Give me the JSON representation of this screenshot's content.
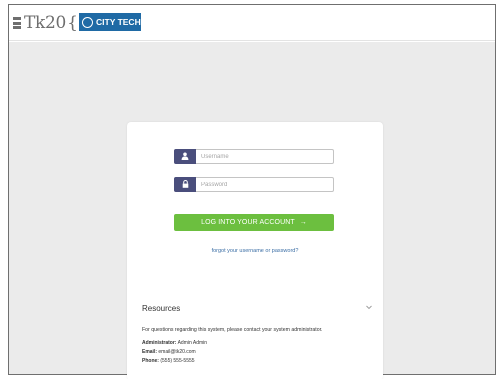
{
  "header": {
    "logo_text": "Tk20",
    "logo_brace": "{",
    "badge_text": "CITY TECH"
  },
  "login": {
    "username_placeholder": "Username",
    "password_placeholder": "Password",
    "login_label": "LOG INTO YOUR ACCOUNT",
    "login_arrow": "→",
    "forgot_link": "forgot your username or password?"
  },
  "resources": {
    "title": "Resources",
    "intro": "For questions regarding this system, please contact your system administrator.",
    "admin_label": "Administrator:",
    "admin_value": "Admin Admin",
    "email_label": "Email:",
    "email_value": "email@tk20.com",
    "phone_label": "Phone:",
    "phone_value": "(555) 555-5555"
  },
  "colors": {
    "accent_green": "#6cbf3f",
    "icon_bg": "#4a4e7c",
    "badge_blue": "#1f6aa5",
    "link_blue": "#3b6ea5"
  },
  "icons": {
    "username": "user-icon",
    "password": "lock-icon",
    "expand": "chevron-down-icon",
    "logo": "tk20-logo-icon",
    "seal": "city-tech-seal-icon"
  }
}
